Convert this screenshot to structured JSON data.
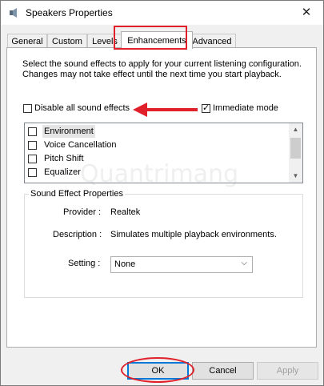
{
  "window": {
    "title": "Speakers Properties",
    "close_glyph": "✕"
  },
  "tabs": [
    {
      "label": "General"
    },
    {
      "label": "Custom"
    },
    {
      "label": "Levels"
    },
    {
      "label": "Enhancements",
      "active": true
    },
    {
      "label": "Advanced"
    }
  ],
  "enhancements": {
    "description": "Select the sound effects to apply for your current listening configuration. Changes may not take effect until the next time you start playback.",
    "disable_all_label": "Disable all sound effects",
    "disable_all_checked": false,
    "immediate_mode_label": "Immediate mode",
    "immediate_mode_checked": true,
    "effects": [
      {
        "label": "Environment",
        "checked": false,
        "selected": true
      },
      {
        "label": "Voice Cancellation",
        "checked": false
      },
      {
        "label": "Pitch Shift",
        "checked": false
      },
      {
        "label": "Equalizer",
        "checked": false
      }
    ]
  },
  "properties": {
    "group_title": "Sound Effect Properties",
    "provider_label": "Provider :",
    "provider_value": "Realtek",
    "description_label": "Description :",
    "description_value": "Simulates multiple playback environments.",
    "setting_label": "Setting :",
    "setting_value": "None"
  },
  "buttons": {
    "ok": "OK",
    "cancel": "Cancel",
    "apply": "Apply"
  },
  "annotation_color": "#e0202a",
  "icons": {
    "app": "speaker-icon",
    "close": "close-icon",
    "dropdown": "chevron-down-icon"
  }
}
